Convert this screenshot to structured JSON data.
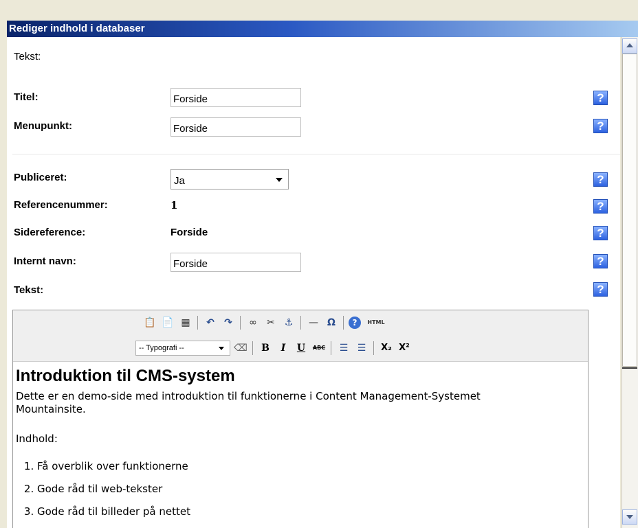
{
  "window": {
    "title": "Rediger indhold i databaser"
  },
  "section_label": "Tekst:",
  "fields": {
    "titel": {
      "label": "Titel:",
      "value": "Forside"
    },
    "menupunkt": {
      "label": "Menupunkt:",
      "value": "Forside"
    },
    "publiceret": {
      "label": "Publiceret:",
      "selected": "Ja"
    },
    "referencenummer": {
      "label": "Referencenummer:",
      "value": "1"
    },
    "sidereference": {
      "label": "Sidereference:",
      "value": "Forside"
    },
    "internt_navn": {
      "label": "Internt navn:",
      "value": "Forside"
    },
    "tekst": {
      "label": "Tekst:"
    }
  },
  "help_icon_glyph": "?",
  "editor": {
    "toolbar_row1": [
      {
        "name": "paste-text-icon",
        "glyph": "📋"
      },
      {
        "name": "paste-word-icon",
        "glyph": "📄"
      },
      {
        "name": "select-all-icon",
        "glyph": "▦"
      },
      {
        "name": "undo-icon",
        "glyph": "↶"
      },
      {
        "name": "redo-icon",
        "glyph": "↷"
      },
      {
        "name": "link-icon",
        "glyph": "∞"
      },
      {
        "name": "unlink-icon",
        "glyph": "✂"
      },
      {
        "name": "anchor-icon",
        "glyph": "⚓"
      },
      {
        "name": "horizontal-rule-icon",
        "glyph": "—"
      },
      {
        "name": "special-char-icon",
        "glyph": "Ω"
      },
      {
        "name": "help-icon",
        "glyph": "?"
      },
      {
        "name": "html-icon",
        "glyph": "HTML"
      }
    ],
    "format_select": "-- Typografi --",
    "toolbar_row2": [
      {
        "name": "clear-format-icon",
        "glyph": "⌫"
      },
      {
        "name": "bold-icon",
        "glyph": "B"
      },
      {
        "name": "italic-icon",
        "glyph": "I"
      },
      {
        "name": "underline-icon",
        "glyph": "U"
      },
      {
        "name": "strikethrough-icon",
        "glyph": "ABC"
      },
      {
        "name": "bullet-list-icon",
        "glyph": "☰"
      },
      {
        "name": "numbered-list-icon",
        "glyph": "☰"
      },
      {
        "name": "subscript-icon",
        "glyph": "X₂"
      },
      {
        "name": "superscript-icon",
        "glyph": "X²"
      }
    ],
    "content": {
      "heading": "Introduktion til CMS-system",
      "paragraph": "Dette er en demo-side med introduktion til funktionerne i Content Management-Systemet Mountainsite.",
      "indhold": "Indhold:",
      "list": [
        "Få overblik over funktionerne",
        "Gode råd til web-tekster",
        "Gode råd til billeder på nettet"
      ]
    }
  },
  "colors": {
    "titlebar_start": "#0a246a",
    "titlebar_end": "#a6caf0",
    "help_icon": "#2d62e0"
  }
}
